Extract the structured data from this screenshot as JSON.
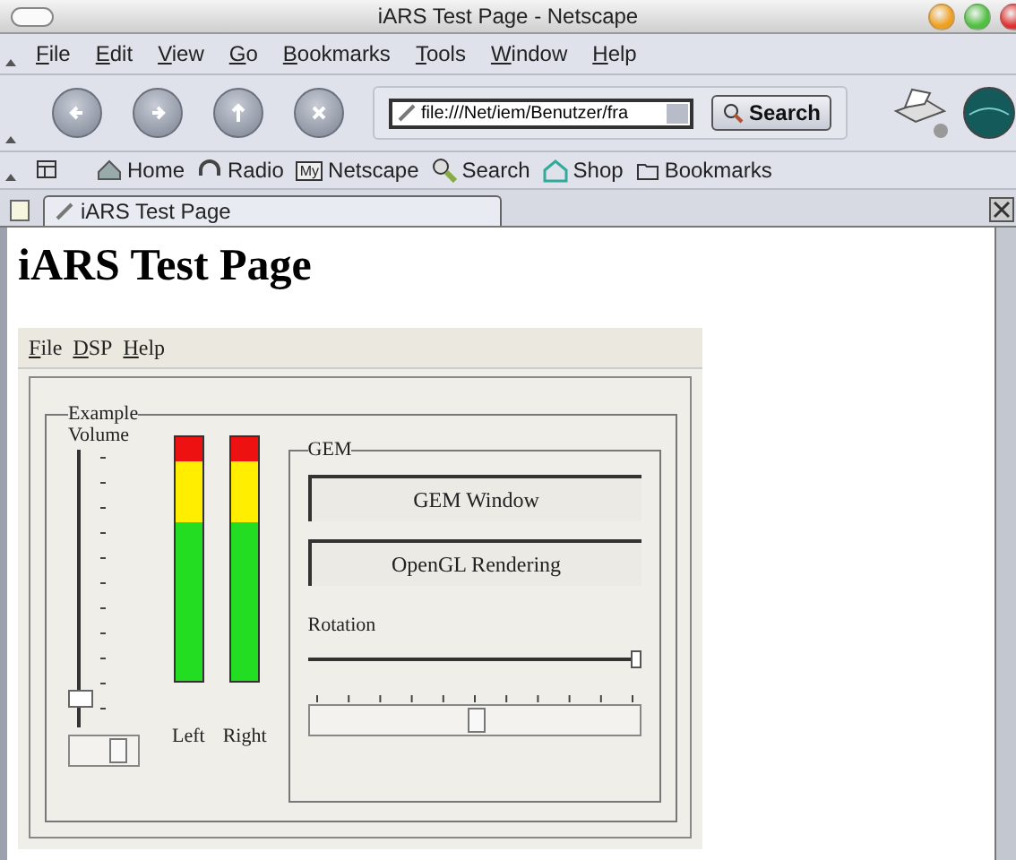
{
  "window": {
    "title": "iARS Test Page - Netscape"
  },
  "menu": [
    "File",
    "Edit",
    "View",
    "Go",
    "Bookmarks",
    "Tools",
    "Window",
    "Help"
  ],
  "address": {
    "value": "file:///Net/iem/Benutzer/fra"
  },
  "search_button": "Search",
  "personal_toolbar": [
    {
      "label": "Home",
      "kind": "home"
    },
    {
      "label": "Radio",
      "kind": "radio"
    },
    {
      "label": "Netscape",
      "kind": "my",
      "icon_text": "My"
    },
    {
      "label": "Search",
      "kind": "search"
    },
    {
      "label": "Shop",
      "kind": "shop"
    },
    {
      "label": "Bookmarks",
      "kind": "folder"
    }
  ],
  "tabs": [
    {
      "label": "iARS Test Page",
      "selected": true
    }
  ],
  "page": {
    "heading": "iARS Test Page",
    "applet": {
      "menu": [
        "File",
        "DSP",
        "Help"
      ],
      "group": "Example",
      "volume": {
        "label": "Volume",
        "level": 0.05
      },
      "meters": [
        {
          "label": "Left",
          "level": 1
        },
        {
          "label": "Right",
          "level": 1
        }
      ],
      "gem": {
        "title": "GEM",
        "buttons": [
          "GEM Window",
          "OpenGL Rendering"
        ],
        "rotation": {
          "label": "Rotation",
          "level": 1
        }
      }
    }
  }
}
